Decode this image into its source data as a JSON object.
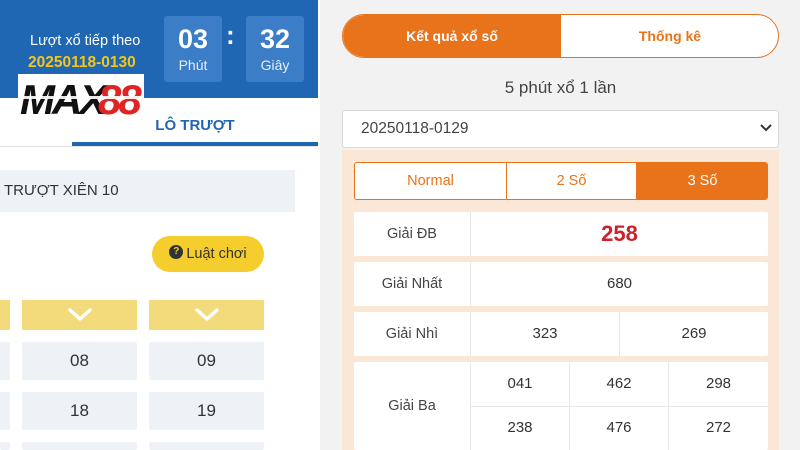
{
  "countdown": {
    "label": "Lượt xổ tiếp theo",
    "code": "20250118-0130",
    "minutes": "03",
    "minutes_unit": "Phút",
    "separator": ":",
    "seconds": "32",
    "seconds_unit": "Giây"
  },
  "logo": {
    "text": "MAX88"
  },
  "left": {
    "tab_label": "LÔ TRƯỢT",
    "subheader": "TRƯỢT XIÊN 10",
    "rules_button": "Luật chơi",
    "rules_icon": "question-circle-icon",
    "numbers": [
      "08",
      "09",
      "18",
      "19"
    ]
  },
  "right": {
    "tabs": [
      "Kết quả xổ số",
      "Thống kê"
    ],
    "frequency": "5 phút xổ 1 lần",
    "draw_select": {
      "value": "20250118-0129"
    },
    "modes": [
      "Normal",
      "2 Số",
      "3 Số"
    ],
    "active_mode": "3 Số",
    "prizes": {
      "special": {
        "label": "Giải ĐB",
        "values": [
          "258"
        ]
      },
      "first": {
        "label": "Giải Nhất",
        "values": [
          "680"
        ]
      },
      "second": {
        "label": "Giải Nhì",
        "values": [
          "323",
          "269"
        ]
      },
      "third": {
        "label": "Giải Ba",
        "values": [
          "041",
          "462",
          "298",
          "238",
          "476",
          "272"
        ]
      }
    }
  },
  "colors": {
    "brand_blue": "#1f66b3",
    "accent_orange": "#e8731b",
    "special_prize_red": "#d0202a",
    "yellow": "#f5cd2c"
  }
}
